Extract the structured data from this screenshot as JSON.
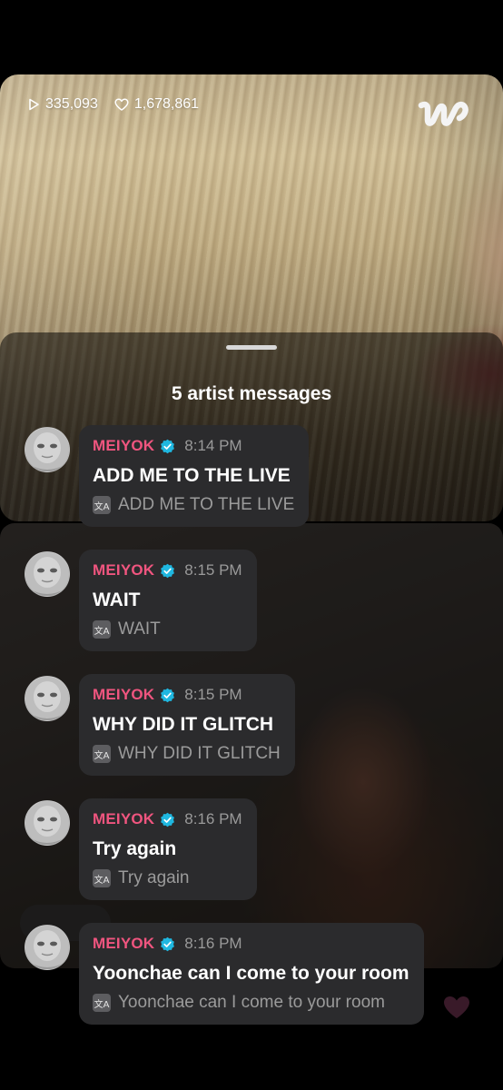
{
  "stats": {
    "views": "335,093",
    "likes": "1,678,861"
  },
  "brand": {
    "logo_glyph": "w",
    "logo_icon": "weverse-logo-icon"
  },
  "sheet": {
    "title": "5 artist messages"
  },
  "messages": [
    {
      "author": "MEIYOK",
      "time": "8:14 PM",
      "text": "ADD ME TO THE LIVE",
      "translation": "ADD ME TO THE LIVE"
    },
    {
      "author": "MEIYOK",
      "time": "8:15 PM",
      "text": "WAIT",
      "translation": "WAIT"
    },
    {
      "author": "MEIYOK",
      "time": "8:15 PM",
      "text": "WHY DID IT GLITCH",
      "translation": "WHY DID IT GLITCH"
    },
    {
      "author": "MEIYOK",
      "time": "8:16 PM",
      "text": "Try again",
      "translation": "Try again"
    },
    {
      "author": "MEIYOK",
      "time": "8:16 PM",
      "text": "Yoonchae can I come to your room",
      "translation": "Yoonchae can I come to your room"
    }
  ],
  "colors": {
    "author": "#f0557f",
    "verified": "#1fb7e0",
    "bubble": "#2b2b2d",
    "heart": "#7e3a5c"
  },
  "icons": {
    "play": "play-icon",
    "heart": "heart-icon",
    "verified": "verified-badge-icon",
    "translate": "translate-icon"
  }
}
